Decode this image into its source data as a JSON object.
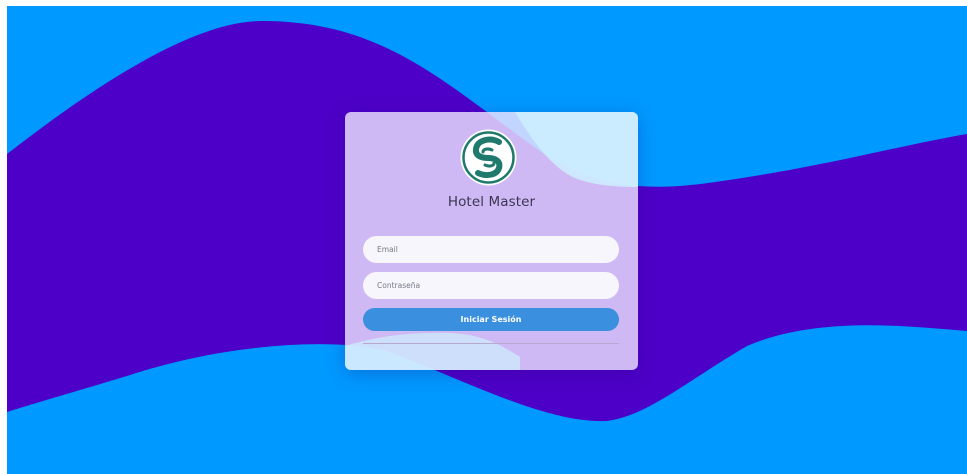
{
  "brand": {
    "name": "Hotel Master",
    "logo_icon": "swirl-logo-icon"
  },
  "login": {
    "email_placeholder": "Email",
    "password_placeholder": "Contraseña",
    "submit_label": "Iniciar Sesión"
  },
  "colors": {
    "background_blue": "#0099ff",
    "wave_purple": "#4d00c7",
    "card_tint": "#ece2ff",
    "button_blue": "#3a8fde",
    "logo_teal": "#1f7a6d"
  }
}
